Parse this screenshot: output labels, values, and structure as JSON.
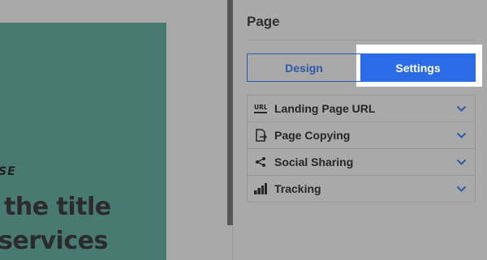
{
  "preview": {
    "eyebrow": "SE",
    "hero_line_1": "the title",
    "hero_line_2": "services"
  },
  "panel": {
    "title": "Page",
    "tabs": [
      {
        "label": "Design",
        "active": false
      },
      {
        "label": "Settings",
        "active": true
      }
    ],
    "sections": [
      {
        "label": "Landing Page URL",
        "icon": "url-icon"
      },
      {
        "label": "Page Copying",
        "icon": "page-copy-icon"
      },
      {
        "label": "Social Sharing",
        "icon": "share-icon"
      },
      {
        "label": "Tracking",
        "icon": "bar-chart-icon"
      }
    ]
  },
  "colors": {
    "accent": "#2b6be6",
    "accent_outline": "#2d59a8",
    "preview_teal": "#487a72"
  }
}
